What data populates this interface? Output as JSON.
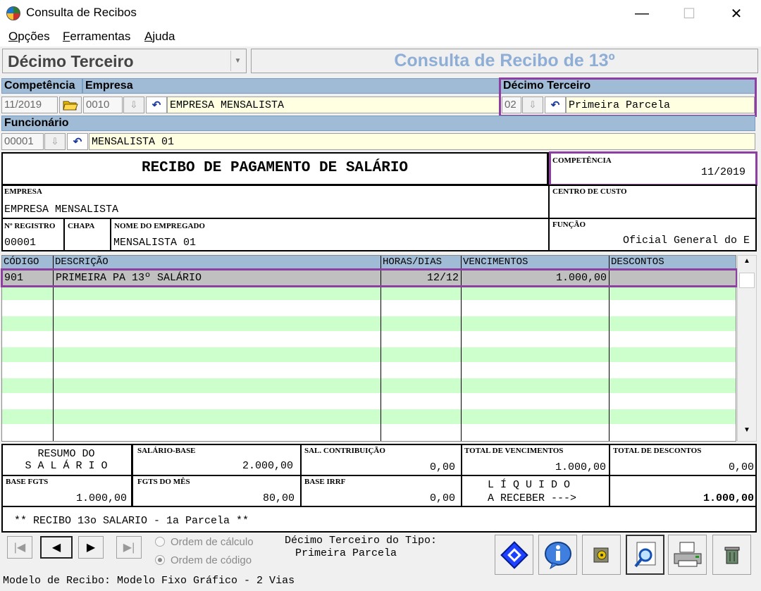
{
  "window": {
    "title": "Consulta de Recibos",
    "minimize": "—",
    "maximize": "☐",
    "close": "✕"
  },
  "menu": {
    "items": [
      {
        "label": "Opções",
        "u": "O",
        "rest": "pções"
      },
      {
        "label": "Ferramentas",
        "u": "F",
        "rest": "erramentas"
      },
      {
        "label": "Ajuda",
        "u": "A",
        "rest": "juda"
      }
    ]
  },
  "toolbar": {
    "type_select_value": "Décimo Terceiro",
    "page_header": "Consulta de Recibo de 13º"
  },
  "filters": {
    "competencia_label": "Competência",
    "competencia_value": "11/2019",
    "empresa_label": "Empresa",
    "empresa_code": "0010",
    "empresa_name": "EMPRESA MENSALISTA",
    "decimo_label": "Décimo Terceiro",
    "decimo_code": "02",
    "decimo_name": "Primeira Parcela",
    "funcionario_label": "Funcionário",
    "funcionario_code": "00001",
    "funcionario_name": "MENSALISTA 01"
  },
  "receipt": {
    "title": "RECIBO DE PAGAMENTO DE SALÁRIO",
    "competencia_label": "COMPETÊNCIA",
    "competencia_value": "11/2019",
    "empresa_label": "EMPRESA",
    "empresa_value": "EMPRESA MENSALISTA",
    "centro_label": "CENTRO DE CUSTO",
    "centro_value": "",
    "registro_label": "Nº REGISTRO",
    "registro_value": "00001",
    "chapa_label": "CHAPA",
    "chapa_value": "",
    "nome_label": "NOME DO EMPREGADO",
    "nome_value": "MENSALISTA 01",
    "funcao_label": "FUNÇÃO",
    "funcao_value": "Oficial General do E"
  },
  "grid": {
    "headers": [
      "CÓDIGO",
      "DESCRIÇÃO",
      "HORAS/DIAS",
      "VENCIMENTOS",
      "DESCONTOS"
    ],
    "rows": [
      {
        "codigo": "901",
        "descricao": "PRIMEIRA PA 13º SALÁRIO",
        "horas": "12/12",
        "vencimentos": "1.000,00",
        "descontos": ""
      }
    ]
  },
  "summary": {
    "resumo_line1": "RESUMO DO",
    "resumo_line2": "S A L Á R I O",
    "salario_base_label": "SALÁRIO-BASE",
    "salario_base_value": "2.000,00",
    "sal_contrib_label": "SAL. CONTRIBUIÇÃO",
    "sal_contrib_value": "0,00",
    "total_venc_label": "TOTAL DE VENCIMENTOS",
    "total_venc_value": "1.000,00",
    "total_desc_label": "TOTAL DE DESCONTOS",
    "total_desc_value": "0,00",
    "base_fgts_label": "BASE FGTS",
    "base_fgts_value": "1.000,00",
    "fgts_mes_label": "FGTS DO MÊS",
    "fgts_mes_value": "80,00",
    "base_irrf_label": "BASE IRRF",
    "base_irrf_value": "0,00",
    "liquido_line1": "L Í Q U I D O",
    "liquido_line2": "A RECEBER --->",
    "liquido_value": "1.000,00",
    "message": "** RECIBO 13o SALARIO - 1a Parcela **"
  },
  "footer": {
    "ordem_calculo": "Ordem de cálculo",
    "ordem_codigo": "Ordem de código",
    "tipo_label": "Décimo Terceiro do Tipo:",
    "tipo_value": "Primeira Parcela",
    "modelo": "Modelo de Recibo: Modelo Fixo Gráfico - 2 Vias"
  }
}
